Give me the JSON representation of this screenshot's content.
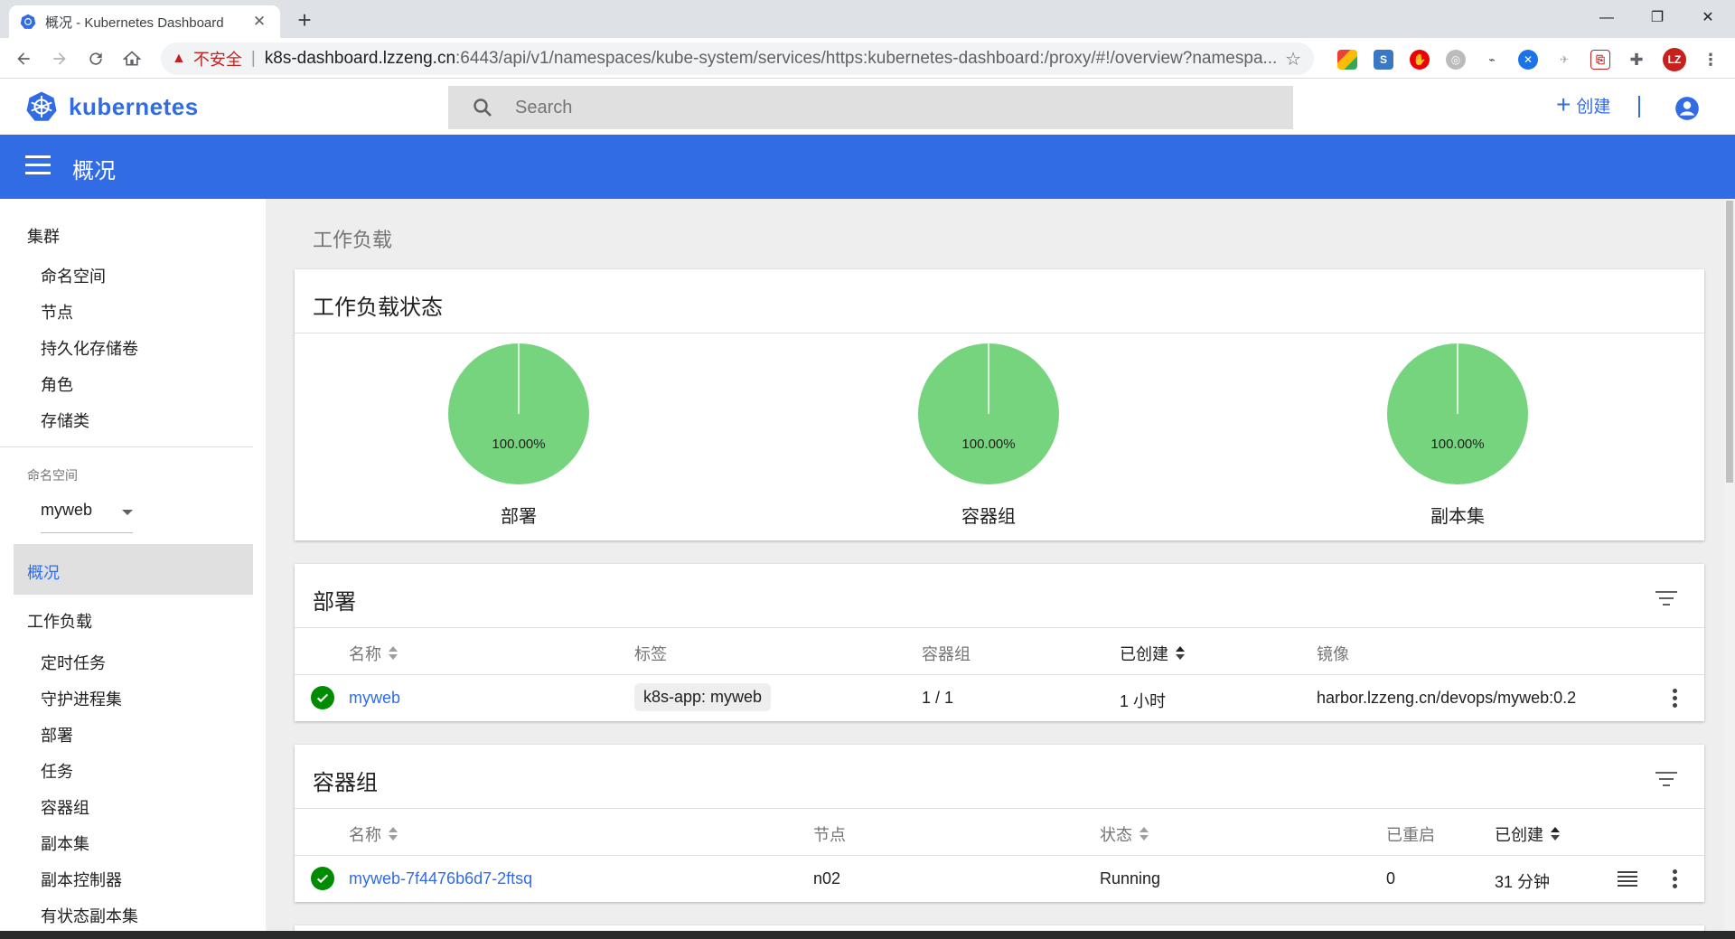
{
  "browser": {
    "tab_title": "概况 - Kubernetes Dashboard",
    "tab_close": "✕",
    "new_tab": "+",
    "insecure_label": "不安全",
    "url_host": "k8s-dashboard.lzzeng.cn",
    "url_rest": ":6443/api/v1/namespaces/kube-system/services/https:kubernetes-dashboard:/proxy/#!/overview?namespa...",
    "profile_initials": "LZ",
    "window_controls": {
      "minimize": "—",
      "restore": "❐",
      "close": "✕"
    }
  },
  "header": {
    "logo_text": "kubernetes",
    "search_placeholder": "Search",
    "create_label": "创建",
    "create_plus": "+"
  },
  "titlebar": {
    "title": "概况"
  },
  "sidebar": {
    "cluster_group": "集群",
    "cluster_items": [
      "命名空间",
      "节点",
      "持久化存储卷",
      "角色",
      "存储类"
    ],
    "namespace_label": "命名空间",
    "namespace_value": "myweb",
    "overview": "概况",
    "workloads_group": "工作负载",
    "workload_items": [
      "定时任务",
      "守护进程集",
      "部署",
      "任务",
      "容器组",
      "副本集",
      "副本控制器",
      "有状态副本集"
    ]
  },
  "main": {
    "section_title": "工作负载",
    "status_card": {
      "title": "工作负载状态",
      "charts": [
        {
          "label": "部署",
          "percent_text": "100.00%",
          "running_fraction": 1.0,
          "color": "#76d47f"
        },
        {
          "label": "容器组",
          "percent_text": "100.00%",
          "running_fraction": 1.0,
          "color": "#76d47f"
        },
        {
          "label": "副本集",
          "percent_text": "100.00%",
          "running_fraction": 1.0,
          "color": "#76d47f"
        }
      ]
    },
    "deployments": {
      "title": "部署",
      "columns": [
        "名称",
        "标签",
        "容器组",
        "已创建",
        "镜像"
      ],
      "rows": [
        {
          "status": "ok",
          "name": "myweb",
          "label": "k8s-app: myweb",
          "pods": "1 / 1",
          "created": "1 小时",
          "image": "harbor.lzzeng.cn/devops/myweb:0.2"
        }
      ]
    },
    "pods": {
      "title": "容器组",
      "columns": [
        "名称",
        "节点",
        "状态",
        "已重启",
        "已创建"
      ],
      "rows": [
        {
          "status": "ok",
          "name": "myweb-7f4476b6d7-2ftsq",
          "node": "n02",
          "state": "Running",
          "restarts": "0",
          "created": "31 分钟"
        }
      ]
    }
  },
  "colors": {
    "brand": "#326ce5",
    "success": "#008c00",
    "chart_green": "#76d47f"
  }
}
